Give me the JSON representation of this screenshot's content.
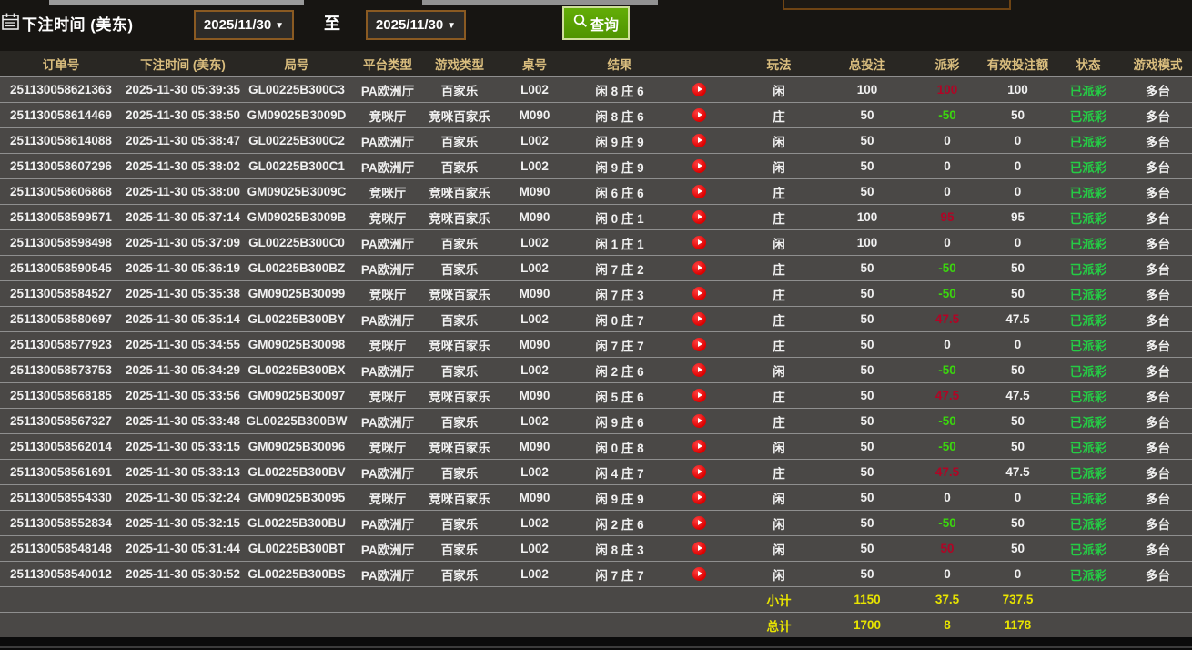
{
  "filter_bar": {
    "label": "下注时间 (美东)",
    "date_from": "2025/11/30",
    "date_to": "2025/11/30",
    "dropdown_arrow": "▼",
    "to_label": "至",
    "search_label": "查询"
  },
  "icons": {
    "calendar": "calendar-icon",
    "magnifier": "search-icon",
    "play": "play-icon"
  },
  "colors": {
    "header_text": "#d9bd7e",
    "row_bg": "#4a4846",
    "payout_positive": "#b10425",
    "payout_negative": "#3bd60e",
    "status_green": "#25cb45",
    "totals_yellow": "#e8e400",
    "button_green": "#55a203",
    "date_border_brown": "#8a5a22"
  },
  "table": {
    "columns": [
      "订单号",
      "下注时间 (美东)",
      "局号",
      "平台类型",
      "游戏类型",
      "桌号",
      "结果",
      "",
      "玩法",
      "总投注",
      "派彩",
      "有效投注额",
      "状态",
      "游戏模式"
    ],
    "rows": [
      {
        "order": "251130058621363",
        "time": "2025-11-30 05:39:35",
        "round": "GL00225B300C3",
        "platform": "PA欧洲厅",
        "game": "百家乐",
        "table_no": "L002",
        "result": "闲 8 庄 6",
        "play": "闲",
        "bet": "100",
        "payout": "100",
        "payout_class": "pos",
        "valid": "100",
        "status": "已派彩",
        "mode": "多台"
      },
      {
        "order": "251130058614469",
        "time": "2025-11-30 05:38:50",
        "round": "GM09025B3009D",
        "platform": "竞咪厅",
        "game": "竞咪百家乐",
        "table_no": "M090",
        "result": "闲 8 庄 6",
        "play": "庄",
        "bet": "50",
        "payout": "-50",
        "payout_class": "neg",
        "valid": "50",
        "status": "已派彩",
        "mode": "多台"
      },
      {
        "order": "251130058614088",
        "time": "2025-11-30 05:38:47",
        "round": "GL00225B300C2",
        "platform": "PA欧洲厅",
        "game": "百家乐",
        "table_no": "L002",
        "result": "闲 9 庄 9",
        "play": "闲",
        "bet": "50",
        "payout": "0",
        "payout_class": "zero",
        "valid": "0",
        "status": "已派彩",
        "mode": "多台"
      },
      {
        "order": "251130058607296",
        "time": "2025-11-30 05:38:02",
        "round": "GL00225B300C1",
        "platform": "PA欧洲厅",
        "game": "百家乐",
        "table_no": "L002",
        "result": "闲 9 庄 9",
        "play": "闲",
        "bet": "50",
        "payout": "0",
        "payout_class": "zero",
        "valid": "0",
        "status": "已派彩",
        "mode": "多台"
      },
      {
        "order": "251130058606868",
        "time": "2025-11-30 05:38:00",
        "round": "GM09025B3009C",
        "platform": "竞咪厅",
        "game": "竞咪百家乐",
        "table_no": "M090",
        "result": "闲 6 庄 6",
        "play": "庄",
        "bet": "50",
        "payout": "0",
        "payout_class": "zero",
        "valid": "0",
        "status": "已派彩",
        "mode": "多台"
      },
      {
        "order": "251130058599571",
        "time": "2025-11-30 05:37:14",
        "round": "GM09025B3009B",
        "platform": "竞咪厅",
        "game": "竞咪百家乐",
        "table_no": "M090",
        "result": "闲 0 庄 1",
        "play": "庄",
        "bet": "100",
        "payout": "95",
        "payout_class": "pos",
        "valid": "95",
        "status": "已派彩",
        "mode": "多台"
      },
      {
        "order": "251130058598498",
        "time": "2025-11-30 05:37:09",
        "round": "GL00225B300C0",
        "platform": "PA欧洲厅",
        "game": "百家乐",
        "table_no": "L002",
        "result": "闲 1 庄 1",
        "play": "闲",
        "bet": "100",
        "payout": "0",
        "payout_class": "zero",
        "valid": "0",
        "status": "已派彩",
        "mode": "多台"
      },
      {
        "order": "251130058590545",
        "time": "2025-11-30 05:36:19",
        "round": "GL00225B300BZ",
        "platform": "PA欧洲厅",
        "game": "百家乐",
        "table_no": "L002",
        "result": "闲 7 庄 2",
        "play": "庄",
        "bet": "50",
        "payout": "-50",
        "payout_class": "neg",
        "valid": "50",
        "status": "已派彩",
        "mode": "多台"
      },
      {
        "order": "251130058584527",
        "time": "2025-11-30 05:35:38",
        "round": "GM09025B30099",
        "platform": "竞咪厅",
        "game": "竞咪百家乐",
        "table_no": "M090",
        "result": "闲 7 庄 3",
        "play": "庄",
        "bet": "50",
        "payout": "-50",
        "payout_class": "neg",
        "valid": "50",
        "status": "已派彩",
        "mode": "多台"
      },
      {
        "order": "251130058580697",
        "time": "2025-11-30 05:35:14",
        "round": "GL00225B300BY",
        "platform": "PA欧洲厅",
        "game": "百家乐",
        "table_no": "L002",
        "result": "闲 0 庄 7",
        "play": "庄",
        "bet": "50",
        "payout": "47.5",
        "payout_class": "pos",
        "valid": "47.5",
        "status": "已派彩",
        "mode": "多台"
      },
      {
        "order": "251130058577923",
        "time": "2025-11-30 05:34:55",
        "round": "GM09025B30098",
        "platform": "竞咪厅",
        "game": "竞咪百家乐",
        "table_no": "M090",
        "result": "闲 7 庄 7",
        "play": "庄",
        "bet": "50",
        "payout": "0",
        "payout_class": "zero",
        "valid": "0",
        "status": "已派彩",
        "mode": "多台"
      },
      {
        "order": "251130058573753",
        "time": "2025-11-30 05:34:29",
        "round": "GL00225B300BX",
        "platform": "PA欧洲厅",
        "game": "百家乐",
        "table_no": "L002",
        "result": "闲 2 庄 6",
        "play": "闲",
        "bet": "50",
        "payout": "-50",
        "payout_class": "neg",
        "valid": "50",
        "status": "已派彩",
        "mode": "多台"
      },
      {
        "order": "251130058568185",
        "time": "2025-11-30 05:33:56",
        "round": "GM09025B30097",
        "platform": "竞咪厅",
        "game": "竞咪百家乐",
        "table_no": "M090",
        "result": "闲 5 庄 6",
        "play": "庄",
        "bet": "50",
        "payout": "47.5",
        "payout_class": "pos",
        "valid": "47.5",
        "status": "已派彩",
        "mode": "多台"
      },
      {
        "order": "251130058567327",
        "time": "2025-11-30 05:33:48",
        "round": "GL00225B300BW",
        "platform": "PA欧洲厅",
        "game": "百家乐",
        "table_no": "L002",
        "result": "闲 9 庄 6",
        "play": "庄",
        "bet": "50",
        "payout": "-50",
        "payout_class": "neg",
        "valid": "50",
        "status": "已派彩",
        "mode": "多台"
      },
      {
        "order": "251130058562014",
        "time": "2025-11-30 05:33:15",
        "round": "GM09025B30096",
        "platform": "竞咪厅",
        "game": "竞咪百家乐",
        "table_no": "M090",
        "result": "闲 0 庄 8",
        "play": "闲",
        "bet": "50",
        "payout": "-50",
        "payout_class": "neg",
        "valid": "50",
        "status": "已派彩",
        "mode": "多台"
      },
      {
        "order": "251130058561691",
        "time": "2025-11-30 05:33:13",
        "round": "GL00225B300BV",
        "platform": "PA欧洲厅",
        "game": "百家乐",
        "table_no": "L002",
        "result": "闲 4 庄 7",
        "play": "庄",
        "bet": "50",
        "payout": "47.5",
        "payout_class": "pos",
        "valid": "47.5",
        "status": "已派彩",
        "mode": "多台"
      },
      {
        "order": "251130058554330",
        "time": "2025-11-30 05:32:24",
        "round": "GM09025B30095",
        "platform": "竞咪厅",
        "game": "竞咪百家乐",
        "table_no": "M090",
        "result": "闲 9 庄 9",
        "play": "闲",
        "bet": "50",
        "payout": "0",
        "payout_class": "zero",
        "valid": "0",
        "status": "已派彩",
        "mode": "多台"
      },
      {
        "order": "251130058552834",
        "time": "2025-11-30 05:32:15",
        "round": "GL00225B300BU",
        "platform": "PA欧洲厅",
        "game": "百家乐",
        "table_no": "L002",
        "result": "闲 2 庄 6",
        "play": "闲",
        "bet": "50",
        "payout": "-50",
        "payout_class": "neg",
        "valid": "50",
        "status": "已派彩",
        "mode": "多台"
      },
      {
        "order": "251130058548148",
        "time": "2025-11-30 05:31:44",
        "round": "GL00225B300BT",
        "platform": "PA欧洲厅",
        "game": "百家乐",
        "table_no": "L002",
        "result": "闲 8 庄 3",
        "play": "闲",
        "bet": "50",
        "payout": "50",
        "payout_class": "pos",
        "valid": "50",
        "status": "已派彩",
        "mode": "多台"
      },
      {
        "order": "251130058540012",
        "time": "2025-11-30 05:30:52",
        "round": "GL00225B300BS",
        "platform": "PA欧洲厅",
        "game": "百家乐",
        "table_no": "L002",
        "result": "闲 7 庄 7",
        "play": "闲",
        "bet": "50",
        "payout": "0",
        "payout_class": "zero",
        "valid": "0",
        "status": "已派彩",
        "mode": "多台"
      }
    ],
    "subtotal": {
      "label": "小计",
      "bet": "1150",
      "payout": "37.5",
      "valid": "737.5"
    },
    "grand_total": {
      "label": "总计",
      "bet": "1700",
      "payout": "8",
      "valid": "1178"
    }
  }
}
